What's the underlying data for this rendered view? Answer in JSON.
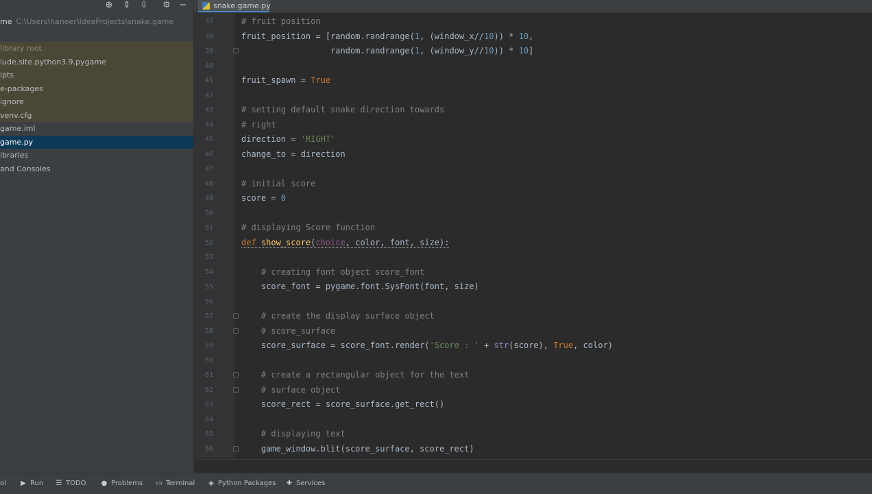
{
  "sidebar": {
    "toolbar_icons": [
      "target-icon",
      "expand-icon",
      "collapse-icon",
      "gear-icon",
      "minimize-icon"
    ],
    "tree": [
      {
        "label": "me",
        "path": "C:\\Users\\haneer\\IdeaProjects\\snake.game",
        "style": "root"
      },
      {
        "label": "",
        "path": "",
        "style": "spacer"
      },
      {
        "label": "library root",
        "path": "",
        "style": "libroot"
      },
      {
        "label": "lude.site.python3.9.pygame",
        "path": "",
        "style": "hl"
      },
      {
        "label": "ipts",
        "path": "",
        "style": "hl"
      },
      {
        "label": "e-packages",
        "path": "",
        "style": "hl"
      },
      {
        "label": "ignore",
        "path": "",
        "style": "hl"
      },
      {
        "label": "venv.cfg",
        "path": "",
        "style": "hl"
      },
      {
        "label": "game.iml",
        "path": "",
        "style": "normal"
      },
      {
        "label": "game.py",
        "path": "",
        "style": "sel"
      },
      {
        "label": "ibraries",
        "path": "",
        "style": "normal"
      },
      {
        "label": "and Consoles",
        "path": "",
        "style": "normal"
      }
    ]
  },
  "tab": {
    "label": "snake.game.py"
  },
  "editor": {
    "lines": [
      {
        "n": "37",
        "html": "<span class=\"c-com\"># fruit position</span>"
      },
      {
        "n": "38",
        "html": "fruit_position = [random.randrange(<span class=\"c-num\">1</span>, (window_x//<span class=\"c-num\">10</span>)) * <span class=\"c-num\">10</span>,"
      },
      {
        "n": "39",
        "html": "                  random.randrange(<span class=\"c-num\">1</span>, (window_y//<span class=\"c-num\">10</span>)) * <span class=\"c-num\">10</span>]",
        "fold": true
      },
      {
        "n": "40",
        "html": ""
      },
      {
        "n": "41",
        "html": "fruit_spawn = <span class=\"c-kw\">True</span>"
      },
      {
        "n": "42",
        "html": ""
      },
      {
        "n": "43",
        "html": "<span class=\"c-com\"># setting default snake direction towards</span>"
      },
      {
        "n": "44",
        "html": "<span class=\"c-com\"># right</span>"
      },
      {
        "n": "45",
        "html": "direction = <span class=\"c-str\">'RIGHT'</span>"
      },
      {
        "n": "46",
        "html": "change_to = direction"
      },
      {
        "n": "47",
        "html": ""
      },
      {
        "n": "48",
        "html": "<span class=\"c-com\"># initial score</span>"
      },
      {
        "n": "49",
        "html": "score = <span class=\"c-num\">0</span>"
      },
      {
        "n": "50",
        "html": ""
      },
      {
        "n": "51",
        "html": "<span class=\"c-com\"># displaying Score function</span>"
      },
      {
        "n": "52",
        "html": "<span class=\"underline\"><span class=\"c-kw\">def</span> <span class=\"c-fn\">show_score</span>(<span class=\"c-par\">choice</span>, color, font, size):</span>"
      },
      {
        "n": "53",
        "html": ""
      },
      {
        "n": "54",
        "html": "    <span class=\"c-com\"># creating font object score_font</span>"
      },
      {
        "n": "55",
        "html": "    score_font = pygame.font.SysFont(font, size)"
      },
      {
        "n": "56",
        "html": ""
      },
      {
        "n": "57",
        "html": "    <span class=\"c-com\"># create the display surface object</span>",
        "fold": true
      },
      {
        "n": "58",
        "html": "    <span class=\"c-com\"># score_surface</span>",
        "fold": true
      },
      {
        "n": "59",
        "html": "    score_surface = score_font.render(<span class=\"c-str\">'Score : '</span> + <span class=\"c-builtin\">str</span>(score), <span class=\"c-kw\">True</span>, color)"
      },
      {
        "n": "60",
        "html": ""
      },
      {
        "n": "61",
        "html": "    <span class=\"c-com\"># create a rectangular object for the text</span>",
        "fold": true
      },
      {
        "n": "62",
        "html": "    <span class=\"c-com\"># surface object</span>",
        "fold": true
      },
      {
        "n": "63",
        "html": "    score_rect = score_surface.get_rect()"
      },
      {
        "n": "64",
        "html": ""
      },
      {
        "n": "65",
        "html": "    <span class=\"c-com\"># displaying text</span>"
      },
      {
        "n": "66",
        "html": "    game_window.blit(score_surface, score_rect)",
        "fold": true
      }
    ]
  },
  "bottombar": {
    "items": [
      {
        "label": "ol",
        "icon": "",
        "name": "tool-partial"
      },
      {
        "label": "Run",
        "icon": "▶",
        "name": "run-tab"
      },
      {
        "label": "TODO",
        "icon": "☰",
        "name": "todo-tab"
      },
      {
        "label": "Problems",
        "icon": "●",
        "name": "problems-tab"
      },
      {
        "label": "Terminal",
        "icon": "▭",
        "name": "terminal-tab"
      },
      {
        "label": "Python Packages",
        "icon": "◈",
        "name": "python-packages-tab"
      },
      {
        "label": "Services",
        "icon": "✚",
        "name": "services-tab"
      }
    ]
  }
}
